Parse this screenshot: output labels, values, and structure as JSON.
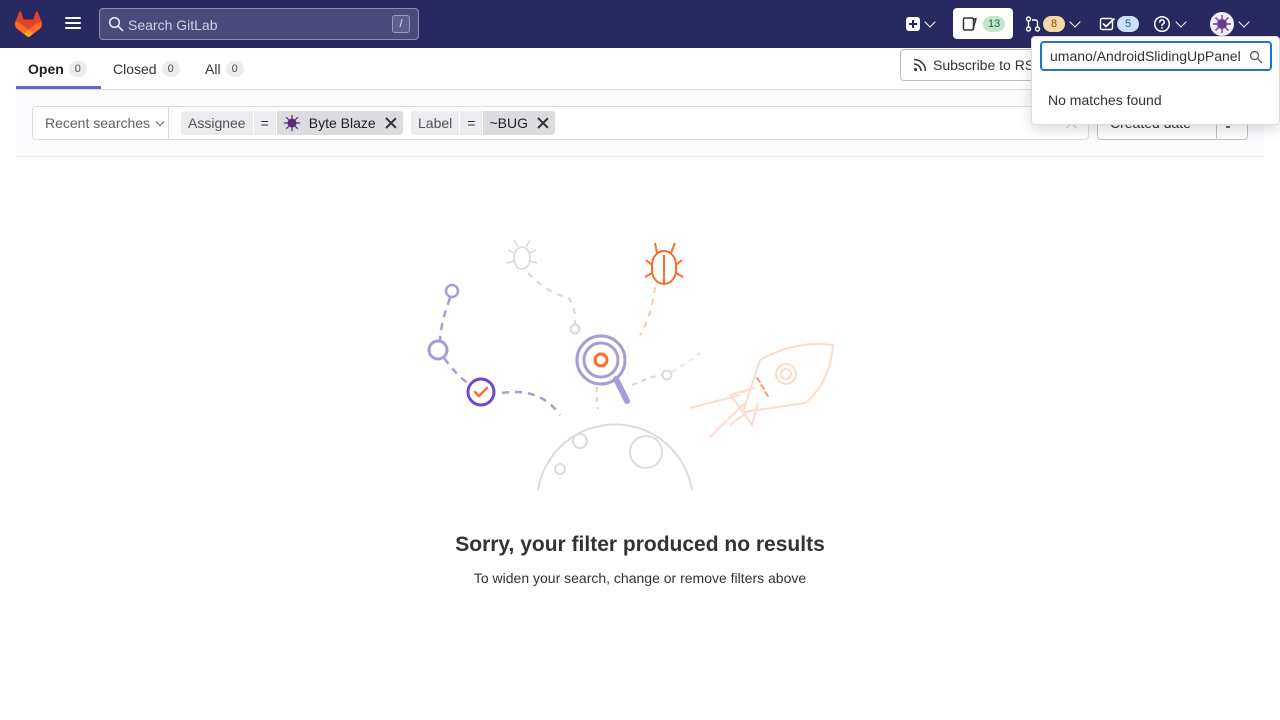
{
  "navbar": {
    "search_placeholder": "Search GitLab",
    "search_shortcut": "/",
    "issues_count": "13",
    "merge_requests_count": "8",
    "todos_count": "5"
  },
  "tabs": [
    {
      "label": "Open",
      "count": "0"
    },
    {
      "label": "Closed",
      "count": "0"
    },
    {
      "label": "All",
      "count": "0"
    }
  ],
  "rss_label": "Subscribe to RSS feed",
  "filter": {
    "recent_searches": "Recent searches",
    "tokens": [
      {
        "key": "Assignee",
        "op": "=",
        "value": "Byte Blaze"
      },
      {
        "key": "Label",
        "op": "=",
        "value": "~BUG"
      }
    ],
    "sort_label": "Created date"
  },
  "dropdown": {
    "input_value": "umano/AndroidSlidingUpPanel",
    "empty_message": "No matches found"
  },
  "empty_state": {
    "title": "Sorry, your filter produced no results",
    "subtitle": "To widen your search, change or remove filters above"
  },
  "colors": {
    "navbar": "#292961",
    "accent": "#6666c4",
    "illustration_purple": "#6e49cb",
    "illustration_orange": "#fc6d26"
  }
}
